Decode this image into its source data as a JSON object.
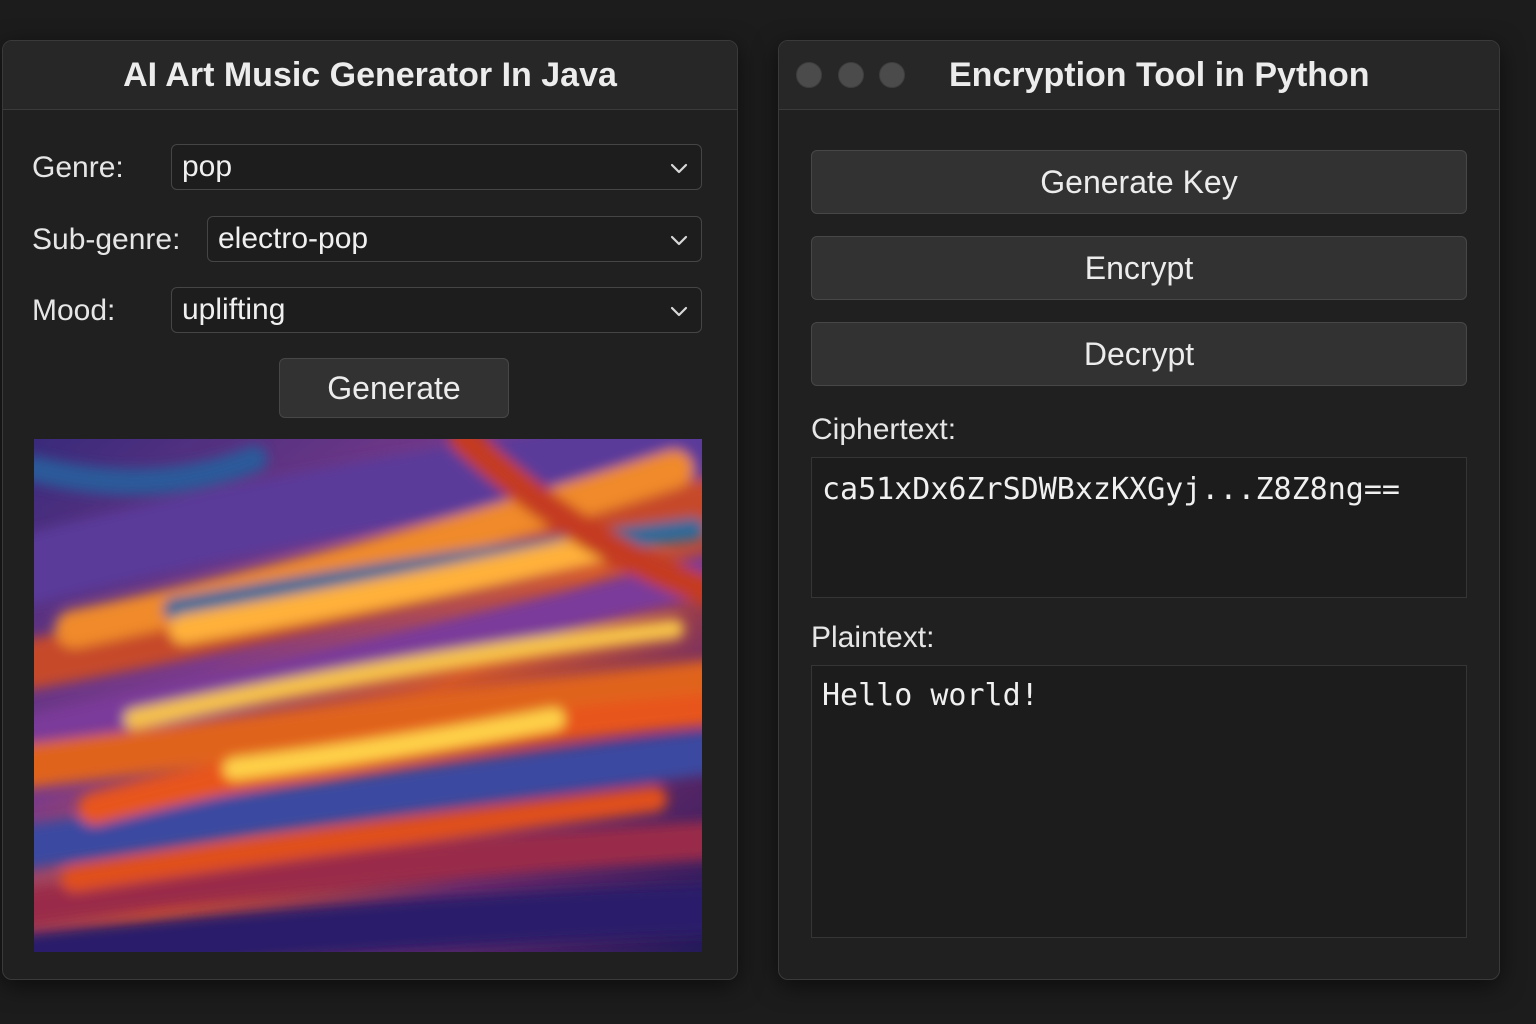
{
  "left_window": {
    "title": "AI Art Music Generator In Java",
    "genre": {
      "label": "Genre:",
      "value": "pop"
    },
    "subgenre": {
      "label": "Sub-genre:",
      "value": "electro-pop"
    },
    "mood": {
      "label": "Mood:",
      "value": "uplifting"
    },
    "generate_label": "Generate",
    "artwork_icon": "abstract-painting"
  },
  "right_window": {
    "title": "Encryption Tool in Python",
    "generate_key_label": "Generate Key",
    "encrypt_label": "Encrypt",
    "decrypt_label": "Decrypt",
    "ciphertext_label": "Ciphertext:",
    "ciphertext_value": "ca51xDx6ZrSDWBxzKXGyj...Z8Z8ng==",
    "plaintext_label": "Plaintext:",
    "plaintext_value": "Hello world!"
  },
  "colors": {
    "background": "#1c1c1c",
    "window": "#202020",
    "titlebar": "#272727",
    "button": "#323232",
    "text": "#e8e8e8"
  }
}
